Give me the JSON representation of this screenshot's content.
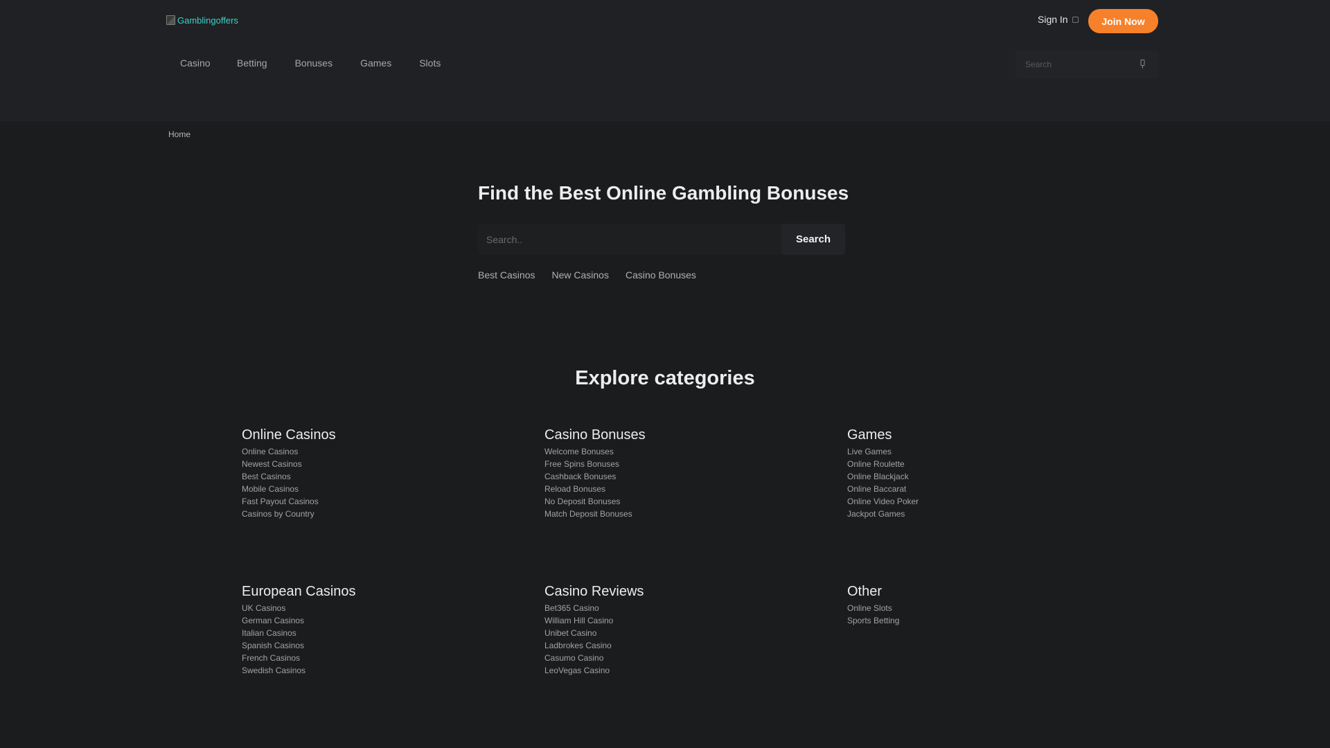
{
  "header": {
    "logo_text": "Gamblingoffers",
    "sign_in": "Sign In",
    "join_now": "Join Now",
    "nav": [
      "Casino",
      "Betting",
      "Bonuses",
      "Games",
      "Slots"
    ],
    "search_placeholder": "Search"
  },
  "breadcrumb": "Home",
  "hero": {
    "title": "Find the Best Online Gambling Bonuses",
    "search_placeholder": "Search..",
    "search_button": "Search",
    "quick_links": [
      "Best Casinos",
      "New Casinos",
      "Casino Bonuses"
    ]
  },
  "categories": {
    "title": "Explore categories",
    "groups": [
      {
        "title": "Online Casinos",
        "items": [
          "Online Casinos",
          "Newest Casinos",
          "Best Casinos",
          "Mobile Casinos",
          "Fast Payout Casinos",
          "Casinos by Country"
        ]
      },
      {
        "title": "Casino Bonuses",
        "items": [
          "Welcome Bonuses",
          "Free Spins Bonuses",
          "Cashback Bonuses",
          "Reload Bonuses",
          "No Deposit Bonuses",
          "Match Deposit Bonuses"
        ]
      },
      {
        "title": "Games",
        "items": [
          "Live Games",
          "Online Roulette",
          "Online Blackjack",
          "Online Baccarat",
          "Online Video Poker",
          "Jackpot Games"
        ]
      },
      {
        "title": "European Casinos",
        "items": [
          "UK Casinos",
          "German Casinos",
          "Italian Casinos",
          "Spanish Casinos",
          "French Casinos",
          "Swedish Casinos"
        ]
      },
      {
        "title": "Casino Reviews",
        "items": [
          "Bet365 Casino",
          "William Hill Casino",
          "Unibet Casino",
          "Ladbrokes Casino",
          "Casumo Casino",
          "LeoVegas Casino"
        ]
      },
      {
        "title": "Other",
        "items": [
          "Online Slots",
          "Sports Betting"
        ]
      }
    ]
  },
  "colors": {
    "accent": "#f7812a",
    "logo": "#3fd0c9",
    "background": "#1b1c1e",
    "header_background": "#202124"
  }
}
